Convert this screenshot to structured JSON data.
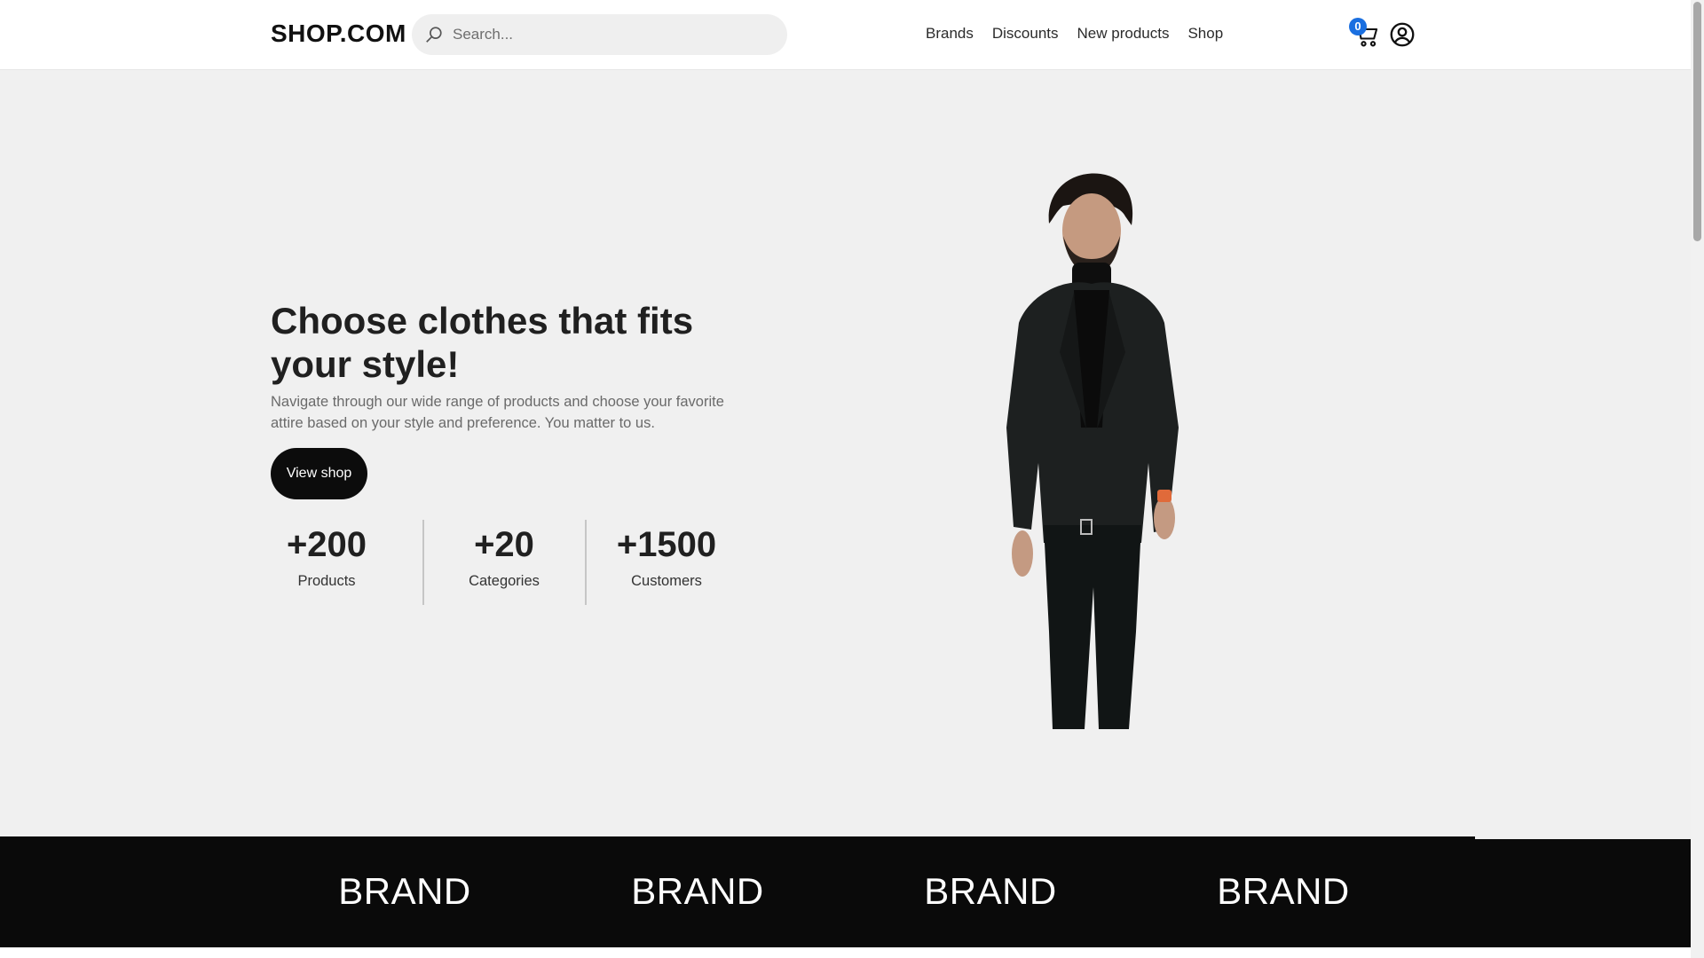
{
  "header": {
    "logo": "SHOP.COM",
    "search": {
      "placeholder": "Search...",
      "value": ""
    },
    "nav": [
      "Brands",
      "Discounts",
      "New products",
      "Shop"
    ],
    "cart_count": "0",
    "icons": {
      "search": "search-icon",
      "cart": "cart-icon",
      "account": "user-circle-icon"
    }
  },
  "hero": {
    "title": "Choose clothes that fits your style!",
    "description": "Navigate through our wide range of products and choose your favorite attire based on your style and preference. You matter to us.",
    "cta": "View shop",
    "stats": [
      {
        "value": "+200",
        "label": "Products"
      },
      {
        "value": "+20",
        "label": "Categories"
      },
      {
        "value": "+1500",
        "label": "Customers"
      }
    ]
  },
  "brands": [
    "BRAND",
    "BRAND",
    "BRAND",
    "BRAND"
  ],
  "colors": {
    "hero_bg": "#f0f0f0",
    "brand_bar": "#0a0a0a",
    "badge": "#1a6fe0",
    "button": "#0c0c0c"
  }
}
